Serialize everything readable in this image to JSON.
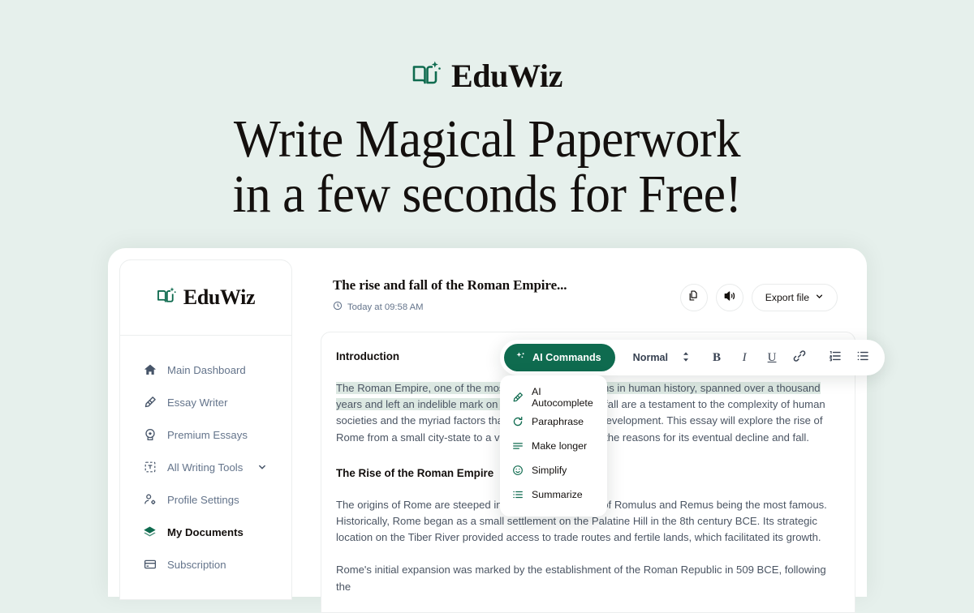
{
  "hero": {
    "brand": "EduWiz",
    "headline_line1": "Write Magical Paperwork",
    "headline_line2": "in a few seconds for Free!"
  },
  "colors": {
    "page_background": "#e6f0ec",
    "brand_green": "#0f6b4f",
    "highlight": "#dce8e2",
    "text_dark": "#14100e",
    "text_muted": "#64748b"
  },
  "sidebar": {
    "brand": "EduWiz",
    "items": [
      {
        "label": "Main Dashboard",
        "icon": "home-icon",
        "active": false,
        "chevron": false
      },
      {
        "label": "Essay Writer",
        "icon": "pencil-icon",
        "active": false,
        "chevron": false
      },
      {
        "label": "Premium Essays",
        "icon": "badge-icon",
        "active": false,
        "chevron": false
      },
      {
        "label": "All Writing Tools",
        "icon": "text-box-icon",
        "active": false,
        "chevron": true
      },
      {
        "label": "Profile Settings",
        "icon": "user-gear-icon",
        "active": false,
        "chevron": false
      },
      {
        "label": "My Documents",
        "icon": "layers-icon",
        "active": true,
        "chevron": false
      },
      {
        "label": "Subscription",
        "icon": "card-icon",
        "active": false,
        "chevron": false
      }
    ]
  },
  "document": {
    "title": "The rise and fall of the Roman Empire...",
    "timestamp": "Today at 09:58 AM",
    "actions": {
      "copy_label": "copy-icon",
      "speak_label": "speaker-icon",
      "export_label": "Export file"
    },
    "body": {
      "heading_1": "Introduction",
      "paragraph_1_highlighted": "The Roman Empire, one of the most significant civilizations in human history, spanned over a thousand years and left an indelible mark on the world.",
      "paragraph_1_rest": " Its rise and fall are a testament to the complexity of human societies and the myriad factors that contributed to their development. This essay will explore the rise of Rome from a small city-state to a vast empire, as well as the reasons for its eventual decline and fall.",
      "heading_2": "The Rise of the Roman Empire",
      "paragraph_2": "The origins of Rome are steeped in legend, with the tale of Romulus and Remus being the most famous. Historically, Rome began as a small settlement on the Palatine Hill in the 8th century BCE. Its strategic location on the Tiber River provided access to trade routes and fertile lands, which facilitated its growth.",
      "paragraph_3": "Rome's initial expansion was marked by the establishment of the Roman Republic in 509 BCE, following the"
    }
  },
  "toolbar": {
    "ai_commands_label": "AI Commands",
    "style_value": "Normal",
    "buttons": [
      {
        "name": "bold-button",
        "glyph": "B"
      },
      {
        "name": "italic-button",
        "glyph": "I"
      },
      {
        "name": "underline-button",
        "glyph": "U"
      },
      {
        "name": "link-button",
        "glyph": "link-icon"
      },
      {
        "name": "numbered-list-button",
        "glyph": "numbered-list-icon"
      },
      {
        "name": "bulleted-list-button",
        "glyph": "bulleted-list-icon"
      }
    ]
  },
  "ai_menu": {
    "items": [
      {
        "label": "AI Autocomplete",
        "icon": "magic-pencil-icon"
      },
      {
        "label": "Paraphrase",
        "icon": "refresh-icon"
      },
      {
        "label": "Make longer",
        "icon": "lines-icon"
      },
      {
        "label": "Simplify",
        "icon": "smiley-icon"
      },
      {
        "label": "Summarize",
        "icon": "summary-list-icon"
      }
    ]
  }
}
